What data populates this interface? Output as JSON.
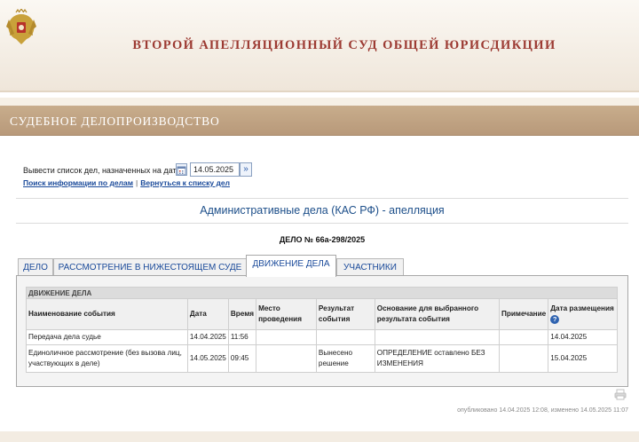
{
  "header": {
    "court_title": "ВТОРОЙ АПЕЛЛЯЦИОННЫЙ СУД ОБЩЕЙ ЮРИСДИКЦИИ",
    "emblem_icon": "coat-of-arms-icon"
  },
  "section": {
    "title": "СУДЕБНОЕ ДЕЛОПРОИЗВОДСТВО"
  },
  "date_filter": {
    "label": "Вывести список дел, назначенных на дату",
    "date_value": "14.05.2025",
    "calendar_icon": "calendar-icon",
    "go_icon": "double-chevron-right-icon"
  },
  "links": {
    "search": "Поиск информации по делам",
    "separator": "|",
    "back": "Вернуться к списку дел"
  },
  "case": {
    "category": "Административные дела (КАС РФ) - апелляция",
    "number": "ДЕЛО № 66а-298/2025"
  },
  "tabs": [
    {
      "label": "ДЕЛО"
    },
    {
      "label": "РАССМОТРЕНИЕ В НИЖЕСТОЯЩЕМ СУДЕ"
    },
    {
      "label": "ДВИЖЕНИЕ ДЕЛА",
      "active": true
    },
    {
      "label": "УЧАСТНИКИ"
    }
  ],
  "table": {
    "group_title": "ДВИЖЕНИЕ ДЕЛА",
    "headers": [
      "Наименование события",
      "Дата",
      "Время",
      "Место проведения",
      "Результат события",
      "Основание для выбранного результата события",
      "Примечание",
      "Дата размещения"
    ],
    "rows": [
      [
        "Передача дела судье",
        "14.04.2025",
        "11:56",
        "",
        "",
        "",
        "",
        "14.04.2025"
      ],
      [
        "Единоличное рассмотрение (без вызова лиц, участвующих в деле)",
        "14.05.2025",
        "09:45",
        "",
        "Вынесено решение",
        "ОПРЕДЕЛЕНИЕ оставлено БЕЗ ИЗМЕНЕНИЯ",
        "",
        "15.04.2025"
      ]
    ],
    "help_icon_label": "?"
  },
  "footer": {
    "published": "опубликовано 14.04.2025 12:08, изменено 14.05.2025 11:07",
    "print_icon": "print-icon"
  },
  "colors": {
    "court_title": "#9c3a32",
    "section_bar": "#b8997a",
    "link": "#1a4a9a",
    "case_category": "#1d4f8a"
  }
}
